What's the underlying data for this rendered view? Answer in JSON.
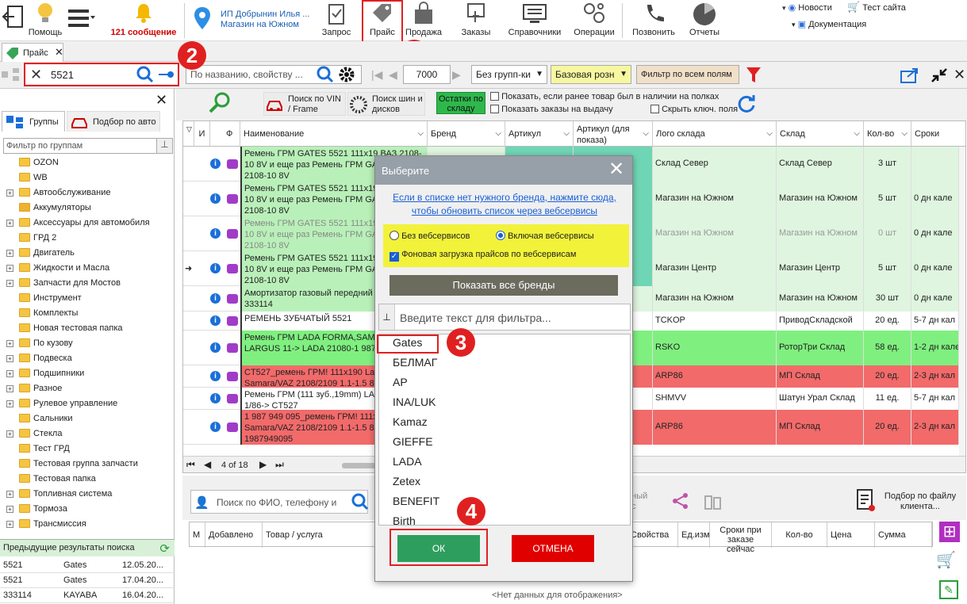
{
  "toolbar": {
    "help": "Помощь",
    "messages": "121 сообщение",
    "company_line1": "ИП Добрынин Илья ...",
    "company_line2": "Магазин на Южном",
    "request": "Запрос",
    "price": "Прайс",
    "sale": "Продажа",
    "orders": "Заказы",
    "references": "Справочники",
    "operations": "Операции",
    "call": "Позвонить",
    "reports": "Отчеты",
    "news": "Новости",
    "test_site": "Тест сайта",
    "documentation": "Документация"
  },
  "tab": {
    "label": "Прайс"
  },
  "filterbar": {
    "search_value": "5521",
    "props_placeholder": "По названию, свойству ...",
    "page_size": "7000",
    "grouping": "Без групп-ки",
    "price_type": "Базовая розн",
    "filter_all": "Фильтр по всем полям"
  },
  "options": {
    "vin_search": "Поиск по VIN / Frame",
    "tire_search": "Поиск шин и дисков",
    "in_stock": "Остатки по складу",
    "show_if_available": "Показать, если ранее товар был в наличии на полках",
    "show_orders": "Показать заказы на выдачу",
    "hide_key_fields": "Скрыть ключ. поля"
  },
  "left": {
    "tab_groups": "Группы",
    "tab_auto": "Подбор по авто",
    "filter_placeholder": "Фильтр  по группам",
    "groups": [
      "OZON",
      "WB",
      "Автообслуживание",
      "Аккумуляторы",
      "Аксессуары для автомобиля",
      "ГРД 2",
      "Двигатель",
      "Жидкости и Масла",
      "Запчасти для Мостов",
      "Инструмент",
      "Комплекты",
      "Новая тестовая папка",
      "По кузову",
      "Подвеска",
      "Подшипники",
      "Разное",
      "Рулевое управление",
      "Сальники",
      "Стекла",
      "Тест ГРД",
      "Тестовая группа запчасти",
      "Тестовая папка",
      "Топливная система",
      "Тормоза",
      "Трансмиссия"
    ],
    "prev_title": "Предыдущие результаты поиска",
    "prev_results": [
      {
        "q": "5521",
        "brand": "Gates",
        "date": "12.05.20..."
      },
      {
        "q": "5521",
        "brand": "Gates",
        "date": "17.04.20..."
      },
      {
        "q": "333114",
        "brand": "KAYABA",
        "date": "16.04.20..."
      }
    ]
  },
  "grid": {
    "headers": {
      "i": "И",
      "f": "Ф",
      "name": "Наименование",
      "brand": "Бренд",
      "article": "Артикул",
      "article_show": "Артикул (для показа)",
      "logo": "Лого склада",
      "stock": "Склад",
      "qty": "Кол-во",
      "terms": "Сроки"
    },
    "rows": [
      {
        "name": "Ремень ГРМ GATES 5521 111х19 ВАЗ 2108-10 8V и еще раз Ремень ГРМ GATES ВАЗ 2108-10 8V",
        "logo": "Склад Север",
        "stock": "Склад Север",
        "qty": "3 шт",
        "terms": ""
      },
      {
        "name": "Ремень ГРМ GATES 5521 111х19 ВАЗ 2108-10 8V и еще раз Ремень ГРМ GATES ВАЗ 2108-10 8V",
        "logo": "Магазин на Южном",
        "stock": "Магазин на Южном",
        "qty": "5 шт",
        "terms": "0 дн кале"
      },
      {
        "name": "Ремень ГРМ GATES 5521 111х19 ВАЗ 2108-10 8V и еще раз Ремень ГРМ GATES ВАЗ 2108-10 8V",
        "logo": "Магазин на Южном",
        "stock": "Магазин на Южном",
        "qty": "0 шт",
        "terms": "0 дн кале"
      },
      {
        "name": "Ремень ГРМ GATES 5521 111х19 ВАЗ 2108-10 8V и еще раз Ремень ГРМ GATES ВАЗ 2108-10 8V",
        "logo": "Магазин Центр",
        "stock": "Магазин Центр",
        "qty": "5 шт",
        "terms": "0 дн кале"
      },
      {
        "name": "Амортизатор газовый передний Excel-G 333114",
        "logo": "Магазин на Южном",
        "stock": "Магазин на Южном",
        "qty": "30 шт",
        "terms": "0 дн кале"
      },
      {
        "name": "РЕМЕНЬ ЗУБЧАТЫЙ 5521",
        "logo": "TCKOP",
        "stock": "ПриводСкладской",
        "qty": "20 ед.",
        "terms": "5-7 дн кал"
      },
      {
        "name": "Ремень ГРМ LADA FORMA,SAMAR LADA LARGUS 11-> LADA 21080-1 987 949 095",
        "logo": "RSKO",
        "stock": "РоторТри Склад",
        "qty": "58 ед.",
        "terms": "1-2 дн кале"
      },
      {
        "name": "CT527_ремень ГРМ! 111х190 Lada Samara/VAZ 2108/2109 1.1-1.5 8",
        "logo": "ARP86",
        "stock": "МП Склад",
        "qty": "20 ед.",
        "terms": "2-3 дн кал"
      },
      {
        "name": "Ремень ГРМ (111 зуб.,19mm) LAD 1.1-1.5 1/86-> CT527",
        "logo": "SHMVV",
        "stock": "Шатун Урал Склад",
        "qty": "11 ед.",
        "terms": "5-7 дн кал"
      },
      {
        "name": "1 987 949 095_ремень ГРМ! 111х Samara/VAZ 2108/2109 1.1-1.5 8 1987949095",
        "logo": "ARP86",
        "stock": "МП Склад",
        "qty": "20 ед.",
        "terms": "2-3 дн кал"
      }
    ],
    "pager": "4 of 18"
  },
  "modal": {
    "title": "Выберите",
    "link": "Если в списке нет нужного бренда, нажмите сюда, чтобы обновить список через вебсервисы",
    "radio1": "Без вебсервисов",
    "radio2": "Включая вебсервисы",
    "checkbox": "Фоновая загрузка прайсов по вебсервисам",
    "show_all": "Показать все бренды",
    "filter_placeholder": "Введите текст для фильтра...",
    "brands": [
      "Gates",
      "БЕЛМАГ",
      "AP",
      "INA/LUK",
      "Kamaz",
      "GIEFFE",
      "LADA",
      "Zetex",
      "BENEFIT",
      "Birth"
    ],
    "ok": "ОК",
    "cancel": "ОТМЕНА"
  },
  "bottom": {
    "search_placeholder": "Поиск по ФИО, телефону и",
    "headers": [
      "М",
      "Добавлено",
      "Товар / услуга",
      "Свойства",
      "Ед.изм",
      "Сроки при заказе сейчас",
      "Кол-во",
      "Цена",
      "Сумма"
    ],
    "file_pick": "Подбор по файлу клиента...",
    "empty": "<Нет данных для отображения>",
    "partial_text": "рный ас"
  },
  "annotations": [
    "1",
    "2",
    "3",
    "4"
  ],
  "colors": {
    "accent_red": "#e02020",
    "row_green": "#b9f0b9",
    "row_red": "#f26a6a",
    "ok_green": "#2e9e5e",
    "cancel_red": "#e00000",
    "yellow": "#f2f23a"
  }
}
